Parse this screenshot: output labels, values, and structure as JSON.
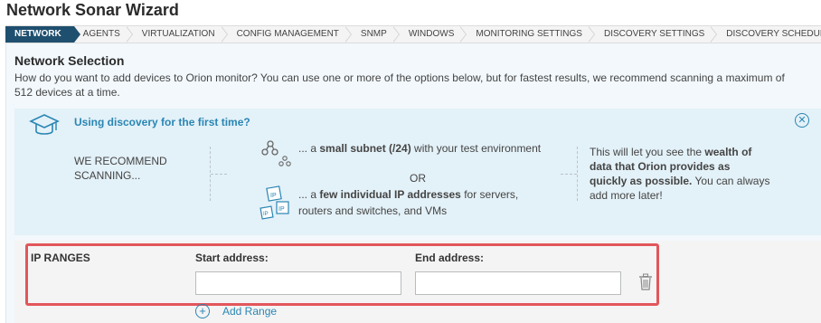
{
  "window": {
    "title": "Network Sonar Wizard"
  },
  "steps": [
    "NETWORK",
    "AGENTS",
    "VIRTUALIZATION",
    "CONFIG MANAGEMENT",
    "SNMP",
    "WINDOWS",
    "MONITORING SETTINGS",
    "DISCOVERY SETTINGS",
    "DISCOVERY SCHEDULING"
  ],
  "section": {
    "title": "Network Selection",
    "description": "How do you want to add devices to Orion monitor? You can use one or more of the options below, but for fastest results, we recommend scanning a maximum of 512 devices at a time."
  },
  "info": {
    "title": "Using discovery for the first time?",
    "recommend": "WE RECOMMEND SCANNING...",
    "option1_prefix": "... a ",
    "option1_bold": "small subnet (/24)",
    "option1_suffix": " with your test environment",
    "or": "OR",
    "option2_prefix": "... a ",
    "option2_bold": "few individual IP addresses",
    "option2_suffix": " for servers, routers and switches, and VMs",
    "note_prefix": "This will let you see the ",
    "note_bold": "wealth of data that Orion provides as quickly as possible.",
    "note_suffix": " You can always add more later!"
  },
  "ip_ranges": {
    "label": "IP RANGES",
    "start_label": "Start address:",
    "end_label": "End address:",
    "start_value": "",
    "end_value": "",
    "add_range": "Add Range"
  },
  "colors": {
    "accent": "#2a86b3",
    "active_step": "#1f4f6e",
    "highlight": "#e2565b",
    "info_bg": "#e3f1f8"
  }
}
